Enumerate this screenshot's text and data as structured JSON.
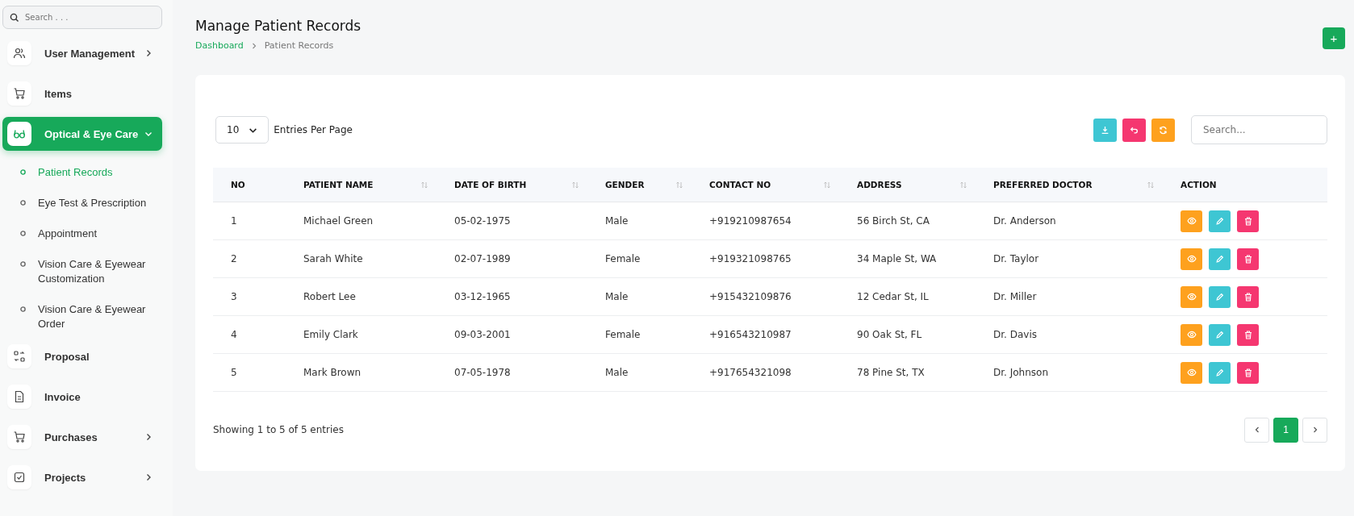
{
  "sidebar": {
    "search": {
      "placeholder": "Search . . ."
    },
    "items": [
      {
        "label": "User Management",
        "kind": "users",
        "expanded": false,
        "selected": false
      },
      {
        "label": "Items",
        "kind": "cart",
        "selected": false
      },
      {
        "label": "Optical & Eye Care",
        "kind": "glasses",
        "expanded": true,
        "selected": true,
        "children": [
          {
            "label": "Patient Records",
            "selected": true
          },
          {
            "label": "Eye Test & Prescription",
            "selected": false
          },
          {
            "label": "Appointment",
            "selected": false
          },
          {
            "label": "Vision Care & Eyewear Customization",
            "selected": false
          },
          {
            "label": "Vision Care & Eyewear Order",
            "selected": false
          }
        ]
      },
      {
        "label": "Proposal",
        "kind": "swap",
        "selected": false
      },
      {
        "label": "Invoice",
        "kind": "file",
        "selected": false
      },
      {
        "label": "Purchases",
        "kind": "cart",
        "expanded": false,
        "selected": false
      },
      {
        "label": "Projects",
        "kind": "check",
        "expanded": false,
        "selected": false
      }
    ]
  },
  "page": {
    "title": "Manage Patient Records",
    "breadcrumb": [
      "Dashboard",
      "Patient Records"
    ],
    "add_button": "+"
  },
  "toolbar": {
    "entries_value": "10",
    "entries_label": "Entries Per Page",
    "search": {
      "placeholder": "Search..."
    }
  },
  "table": {
    "columns": [
      {
        "label": "NO",
        "sortable": false
      },
      {
        "label": "PATIENT NAME",
        "sortable": true
      },
      {
        "label": "DATE OF BIRTH",
        "sortable": true
      },
      {
        "label": "GENDER",
        "sortable": true
      },
      {
        "label": "CONTACT NO",
        "sortable": true
      },
      {
        "label": "ADDRESS",
        "sortable": true
      },
      {
        "label": "PREFERRED DOCTOR",
        "sortable": true
      },
      {
        "label": "ACTION",
        "sortable": false
      }
    ],
    "rows": [
      [
        "1",
        "Michael Green",
        "05-02-1975",
        "Male",
        "+919210987654",
        "56 Birch St, CA",
        "Dr. Anderson"
      ],
      [
        "2",
        "Sarah White",
        "02-07-1989",
        "Female",
        "+919321098765",
        "34 Maple St, WA",
        "Dr. Taylor"
      ],
      [
        "3",
        "Robert Lee",
        "03-12-1965",
        "Male",
        "+915432109876",
        "12 Cedar St, IL",
        "Dr. Miller"
      ],
      [
        "4",
        "Emily Clark",
        "09-03-2001",
        "Female",
        "+916543210987",
        "90 Oak St, FL",
        "Dr. Davis"
      ],
      [
        "5",
        "Mark Brown",
        "07-05-1978",
        "Male",
        "+917654321098",
        "78 Pine St, TX",
        "Dr. Johnson"
      ]
    ]
  },
  "footer": {
    "summary": "Showing 1 to 5 of 5 entries",
    "pages": [
      {
        "label": "1",
        "selected": true
      }
    ]
  }
}
